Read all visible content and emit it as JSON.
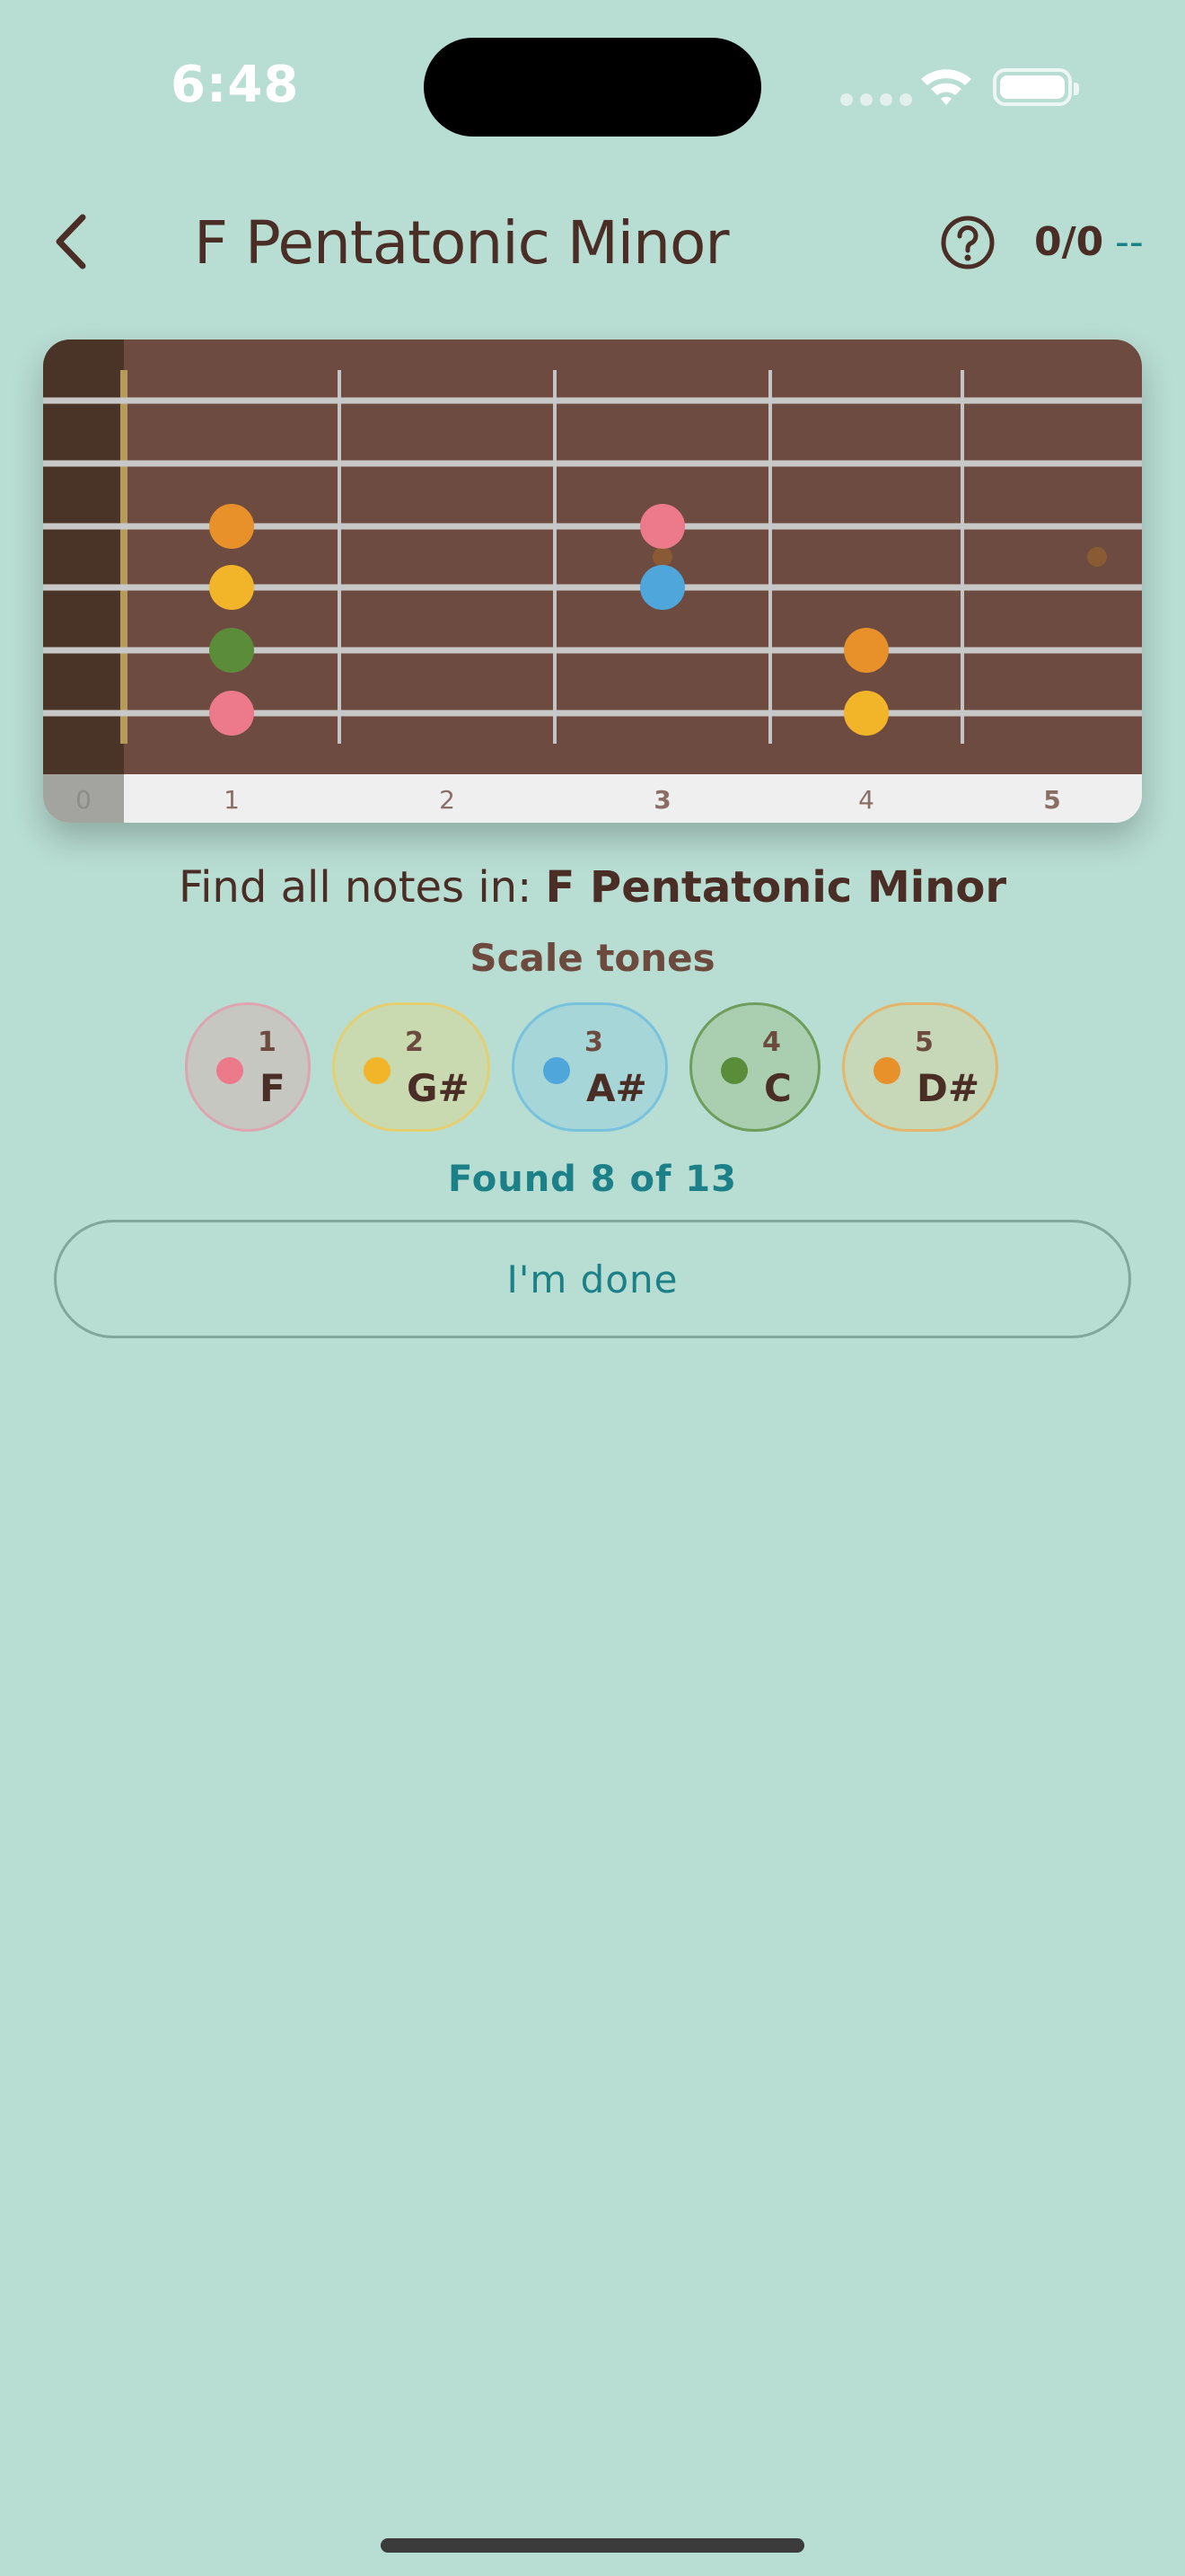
{
  "status_bar": {
    "time": "6:48"
  },
  "header": {
    "title": "F Pentatonic Minor",
    "score": "0/0",
    "streak": "--"
  },
  "fretboard": {
    "fret_numbers": [
      "0",
      "1",
      "2",
      "3",
      "4",
      "5"
    ],
    "strings": 6,
    "colors": {
      "wood": "#6e4b40",
      "nut_area": "#4a3428",
      "nut": "#b59a5a",
      "string": "#c8c8c8",
      "fret": "#c4c4c4"
    },
    "markers": [
      {
        "string": 3,
        "fret": 1,
        "color": "#e8912a"
      },
      {
        "string": 4,
        "fret": 1,
        "color": "#f2b52a"
      },
      {
        "string": 5,
        "fret": 1,
        "color": "#5a8c3a"
      },
      {
        "string": 6,
        "fret": 1,
        "color": "#ec7a8a"
      },
      {
        "string": 3,
        "fret": 3,
        "color": "#ec7a8a"
      },
      {
        "string": 4,
        "fret": 3,
        "color": "#4fa6da"
      },
      {
        "string": 5,
        "fret": 4,
        "color": "#e8912a"
      },
      {
        "string": 6,
        "fret": 4,
        "color": "#f2b52a"
      }
    ],
    "inlays": [
      {
        "fret": 3,
        "position": "between-3-4"
      },
      {
        "fret": 5,
        "position": "between-3-4"
      }
    ]
  },
  "prompt": {
    "prefix": "Find all notes in: ",
    "scale_name": "F Pentatonic Minor"
  },
  "scale_tones_heading": "Scale tones",
  "tones": [
    {
      "degree": "1",
      "note": "F",
      "color": "#ec7a8a",
      "bg": "#c7c7c2",
      "border": "#dca5b0"
    },
    {
      "degree": "2",
      "note": "G#",
      "color": "#f2b52a",
      "bg": "#c9d9b0",
      "border": "#e5cf73"
    },
    {
      "degree": "3",
      "note": "A#",
      "color": "#4fa6da",
      "bg": "#a7d6d9",
      "border": "#79c2de"
    },
    {
      "degree": "4",
      "note": "C",
      "color": "#5a8c3a",
      "bg": "#a9cfb0",
      "border": "#6e9d5c"
    },
    {
      "degree": "5",
      "note": "D#",
      "color": "#e8912a",
      "bg": "#c6d8b8",
      "border": "#e3b66b"
    }
  ],
  "found_text": "Found 8 of 13",
  "done_button_label": "I'm done"
}
